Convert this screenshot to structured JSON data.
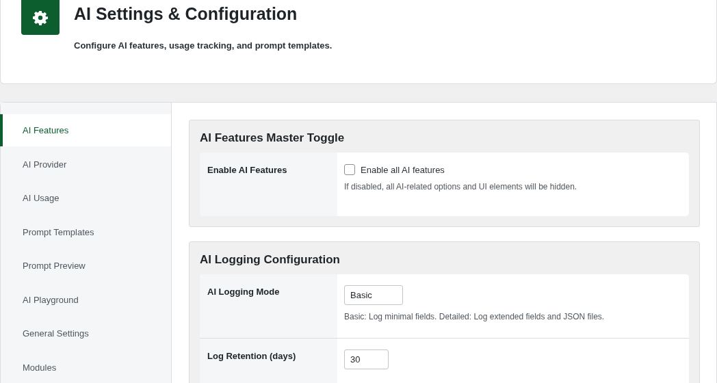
{
  "header": {
    "title": "AI Settings & Configuration",
    "subtitle": "Configure AI features, usage tracking, and prompt templates."
  },
  "sidebar": {
    "items": [
      {
        "label": "AI Features",
        "selected": true
      },
      {
        "label": "AI Provider",
        "selected": false
      },
      {
        "label": "AI Usage",
        "selected": false
      },
      {
        "label": "Prompt Templates",
        "selected": false
      },
      {
        "label": "Prompt Preview",
        "selected": false
      },
      {
        "label": "AI Playground",
        "selected": false
      },
      {
        "label": "General Settings",
        "selected": false
      },
      {
        "label": "Modules",
        "selected": false
      }
    ]
  },
  "sections": [
    {
      "title": "AI Features Master Toggle",
      "rows": [
        {
          "kind": "checkbox",
          "label": "Enable AI Features",
          "option_label": "Enable all AI features",
          "checked": false,
          "help": "If disabled, all AI-related options and UI elements will be hidden."
        }
      ]
    },
    {
      "title": "AI Logging Configuration",
      "rows": [
        {
          "kind": "select",
          "label": "AI Logging Mode",
          "value": "Basic",
          "help": "Basic: Log minimal fields. Detailed: Log extended fields and JSON files."
        },
        {
          "kind": "number",
          "label": "Log Retention (days)",
          "value": "30"
        }
      ]
    }
  ]
}
